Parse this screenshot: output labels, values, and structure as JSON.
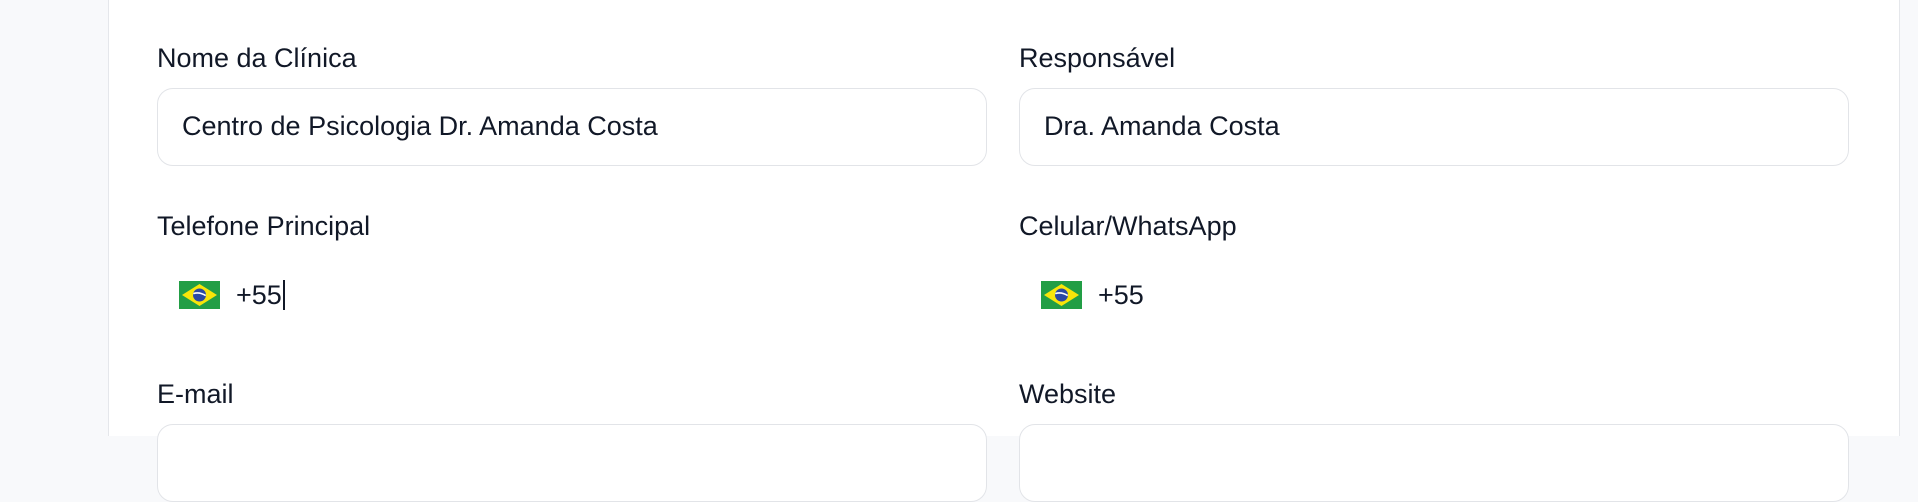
{
  "form": {
    "clinic_name": {
      "label": "Nome da Clínica",
      "value": "Centro de Psicologia Dr. Amanda Costa"
    },
    "responsible": {
      "label": "Responsável",
      "value": "Dra. Amanda Costa"
    },
    "main_phone": {
      "label": "Telefone Principal",
      "country_flag": "brazil-flag-icon",
      "dial_code": "+55"
    },
    "mobile_whatsapp": {
      "label": "Celular/WhatsApp",
      "country_flag": "brazil-flag-icon",
      "dial_code": "+55"
    },
    "email": {
      "label": "E-mail",
      "value": ""
    },
    "website": {
      "label": "Website",
      "value": ""
    }
  },
  "colors": {
    "page_background": "#f8f9fb",
    "card_background": "#ffffff",
    "input_border": "#e2e4e8",
    "text": "#111827"
  }
}
